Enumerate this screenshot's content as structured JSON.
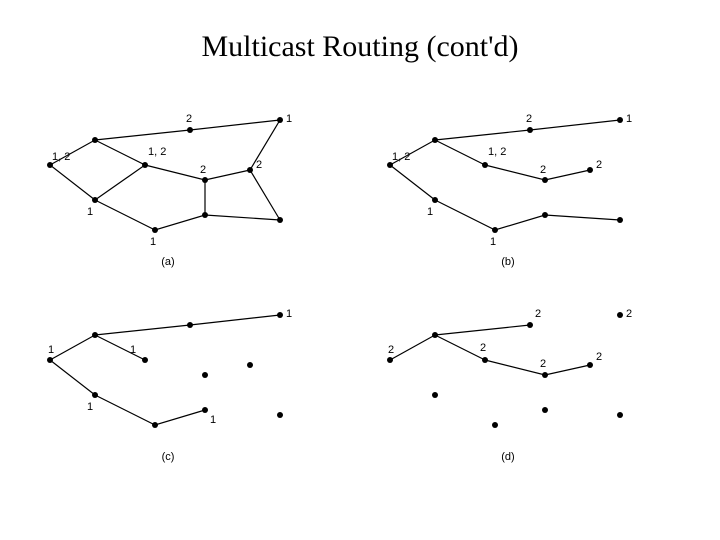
{
  "title": "Multicast Routing (cont'd)",
  "panels": {
    "a": {
      "caption": "(a)",
      "node_labels": [
        "1, 2",
        "1, 2",
        "1",
        "2",
        "1",
        "2",
        "2",
        "1"
      ]
    },
    "b": {
      "caption": "(b)",
      "node_labels": [
        "1, 2",
        "1, 2",
        "1",
        "2",
        "1",
        "2",
        "2",
        "1"
      ]
    },
    "c": {
      "caption": "(c)",
      "node_labels": [
        "1",
        "1",
        "1",
        "1",
        "1"
      ]
    },
    "d": {
      "caption": "(d)",
      "node_labels": [
        "2",
        "2",
        "2",
        "2",
        "2",
        "2"
      ]
    }
  }
}
